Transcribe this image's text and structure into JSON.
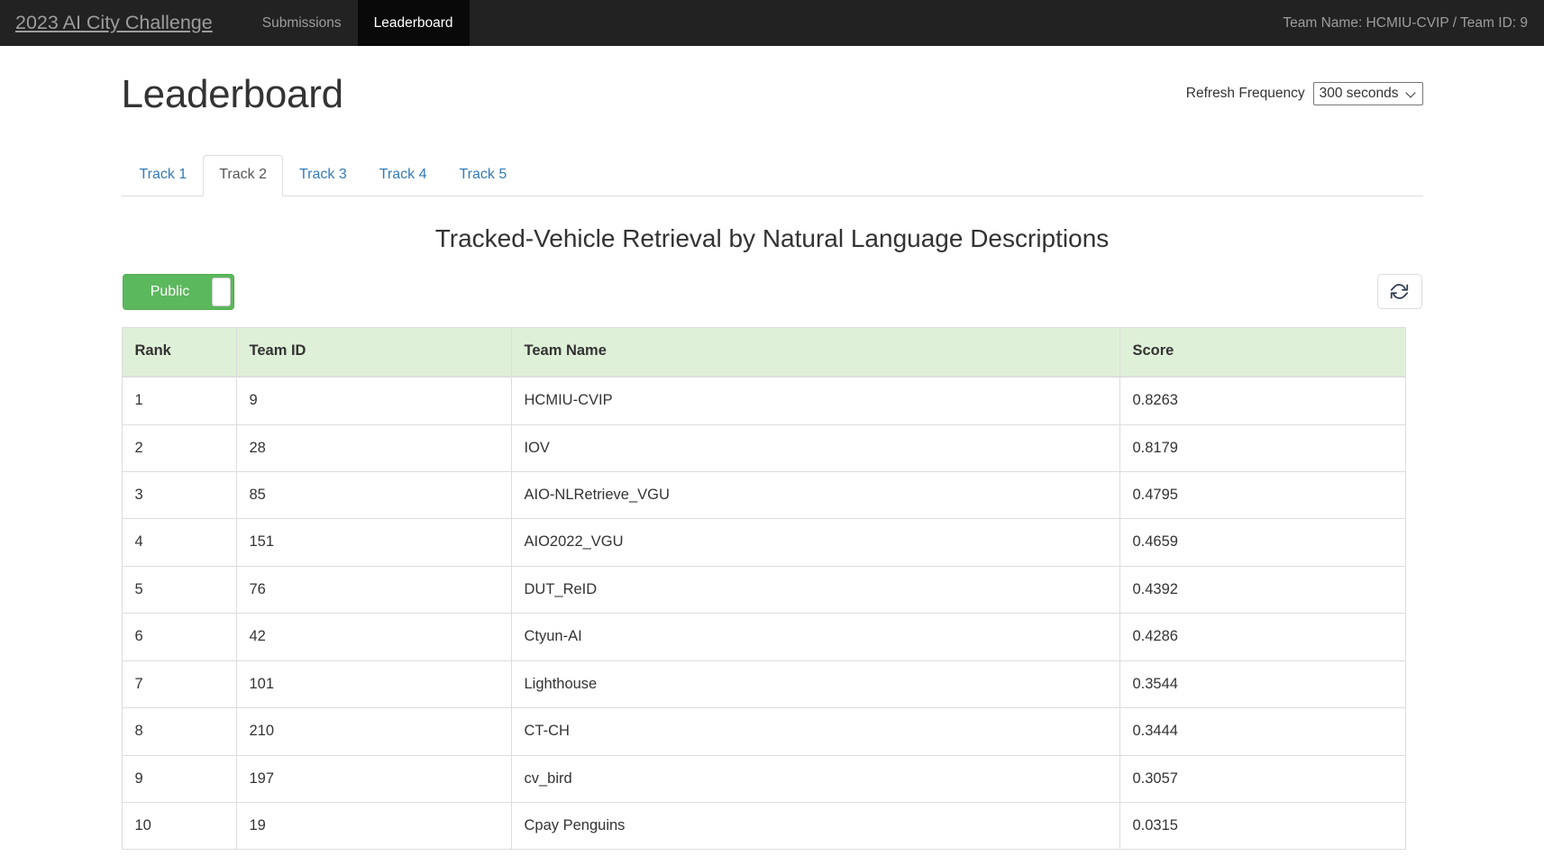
{
  "navbar": {
    "brand": "2023 AI City Challenge",
    "links": [
      {
        "label": "Submissions",
        "active": false
      },
      {
        "label": "Leaderboard",
        "active": true
      }
    ],
    "user_info": "Team Name: HCMIU-CVIP / Team ID: 9"
  },
  "header": {
    "title": "Leaderboard",
    "refresh_frequency_label": "Refresh Frequency",
    "refresh_frequency_value": "300 seconds"
  },
  "tabs": [
    {
      "label": "Track 1",
      "active": false
    },
    {
      "label": "Track 2",
      "active": true
    },
    {
      "label": "Track 3",
      "active": false
    },
    {
      "label": "Track 4",
      "active": false
    },
    {
      "label": "Track 5",
      "active": false
    }
  ],
  "section": {
    "title": "Tracked-Vehicle Retrieval by Natural Language Descriptions"
  },
  "toolbar": {
    "visibility_toggle_label": "Public",
    "refresh_button_icon": "refresh-icon"
  },
  "table": {
    "columns": [
      "Rank",
      "Team ID",
      "Team Name",
      "Score"
    ],
    "rows": [
      {
        "rank": "1",
        "team_id": "9",
        "team_name": "HCMIU-CVIP",
        "score": "0.8263"
      },
      {
        "rank": "2",
        "team_id": "28",
        "team_name": "IOV",
        "score": "0.8179"
      },
      {
        "rank": "3",
        "team_id": "85",
        "team_name": "AIO-NLRetrieve_VGU",
        "score": "0.4795"
      },
      {
        "rank": "4",
        "team_id": "151",
        "team_name": "AIO2022_VGU",
        "score": "0.4659"
      },
      {
        "rank": "5",
        "team_id": "76",
        "team_name": "DUT_ReID",
        "score": "0.4392"
      },
      {
        "rank": "6",
        "team_id": "42",
        "team_name": "Ctyun-AI",
        "score": "0.4286"
      },
      {
        "rank": "7",
        "team_id": "101",
        "team_name": "Lighthouse",
        "score": "0.3544"
      },
      {
        "rank": "8",
        "team_id": "210",
        "team_name": "CT-CH",
        "score": "0.3444"
      },
      {
        "rank": "9",
        "team_id": "197",
        "team_name": "cv_bird",
        "score": "0.3057"
      },
      {
        "rank": "10",
        "team_id": "19",
        "team_name": "Cpay Penguins",
        "score": "0.0315"
      }
    ]
  },
  "colors": {
    "navbar_bg": "#222222",
    "navbar_active_bg": "#090909",
    "link": "#337ab7",
    "table_header_bg": "#dff0d8",
    "toggle_green": "#5cb85c"
  }
}
